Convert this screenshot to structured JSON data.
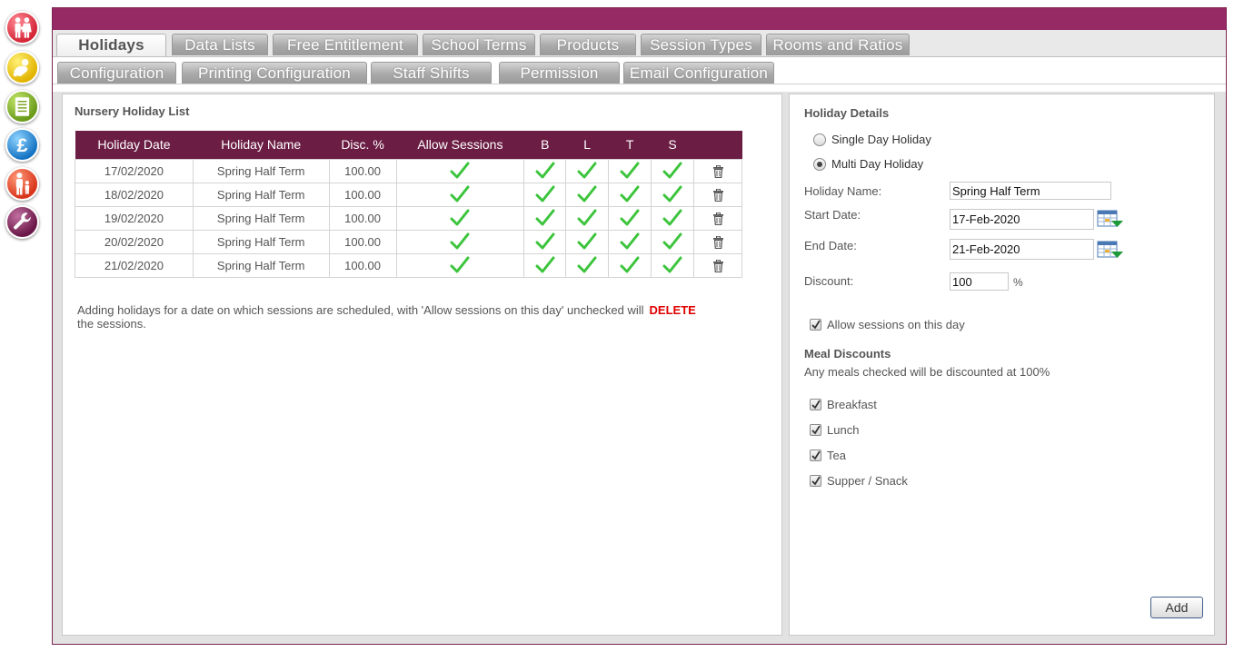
{
  "nav_icons": [
    {
      "name": "family-icon"
    },
    {
      "name": "child-icon"
    },
    {
      "name": "register-icon"
    },
    {
      "name": "pound-icon"
    },
    {
      "name": "staff-icon"
    },
    {
      "name": "wrench-icon"
    }
  ],
  "tabs_row1": [
    {
      "label": "Holidays",
      "active": true
    },
    {
      "label": "Data Lists"
    },
    {
      "label": "Free Entitlement"
    },
    {
      "label": "School Terms"
    },
    {
      "label": "Products"
    },
    {
      "label": "Session Types"
    },
    {
      "label": "Rooms and Ratios"
    }
  ],
  "tabs_row2": [
    {
      "label": "Configuration"
    },
    {
      "label": "Printing Configuration"
    },
    {
      "label": "Staff Shifts"
    },
    {
      "label": "Permission"
    },
    {
      "label": "Email Configuration"
    }
  ],
  "holiday_list": {
    "title": "Nursery Holiday List",
    "columns": [
      "Holiday Date",
      "Holiday Name",
      "Disc. %",
      "Allow Sessions",
      "B",
      "L",
      "T",
      "S",
      ""
    ],
    "rows": [
      {
        "date": "17/02/2020",
        "name": "Spring Half Term",
        "disc": "100.00"
      },
      {
        "date": "18/02/2020",
        "name": "Spring Half Term",
        "disc": "100.00"
      },
      {
        "date": "19/02/2020",
        "name": "Spring Half Term",
        "disc": "100.00"
      },
      {
        "date": "20/02/2020",
        "name": "Spring Half Term",
        "disc": "100.00"
      },
      {
        "date": "21/02/2020",
        "name": "Spring Half Term",
        "disc": "100.00"
      }
    ],
    "warning_text": "Adding holidays for a date on which sessions are scheduled, with 'Allow sessions on this day' unchecked will",
    "warning_delete": "DELETE",
    "warning_tail": "the sessions."
  },
  "details": {
    "title": "Holiday Details",
    "single_day_label": "Single Day Holiday",
    "multi_day_label": "Multi Day Holiday",
    "selected": "multi",
    "name_label": "Holiday Name:",
    "name_value": "Spring Half Term",
    "start_label": "Start Date:",
    "start_value": "17-Feb-2020",
    "end_label": "End Date:",
    "end_value": "21-Feb-2020",
    "discount_label": "Discount:",
    "discount_value": "100",
    "discount_unit": "%",
    "allow_sessions_label": "Allow sessions on this day",
    "meal_title": "Meal Discounts",
    "meal_note": "Any meals checked will be discounted at 100%",
    "meals": [
      {
        "label": "Breakfast",
        "checked": true
      },
      {
        "label": "Lunch",
        "checked": true
      },
      {
        "label": "Tea",
        "checked": true
      },
      {
        "label": "Supper / Snack",
        "checked": true
      }
    ],
    "add_label": "Add"
  },
  "colors": {
    "brand": "#962a64",
    "header": "#6b1d44",
    "check": "#3cc43c",
    "delete": "#e00000"
  }
}
